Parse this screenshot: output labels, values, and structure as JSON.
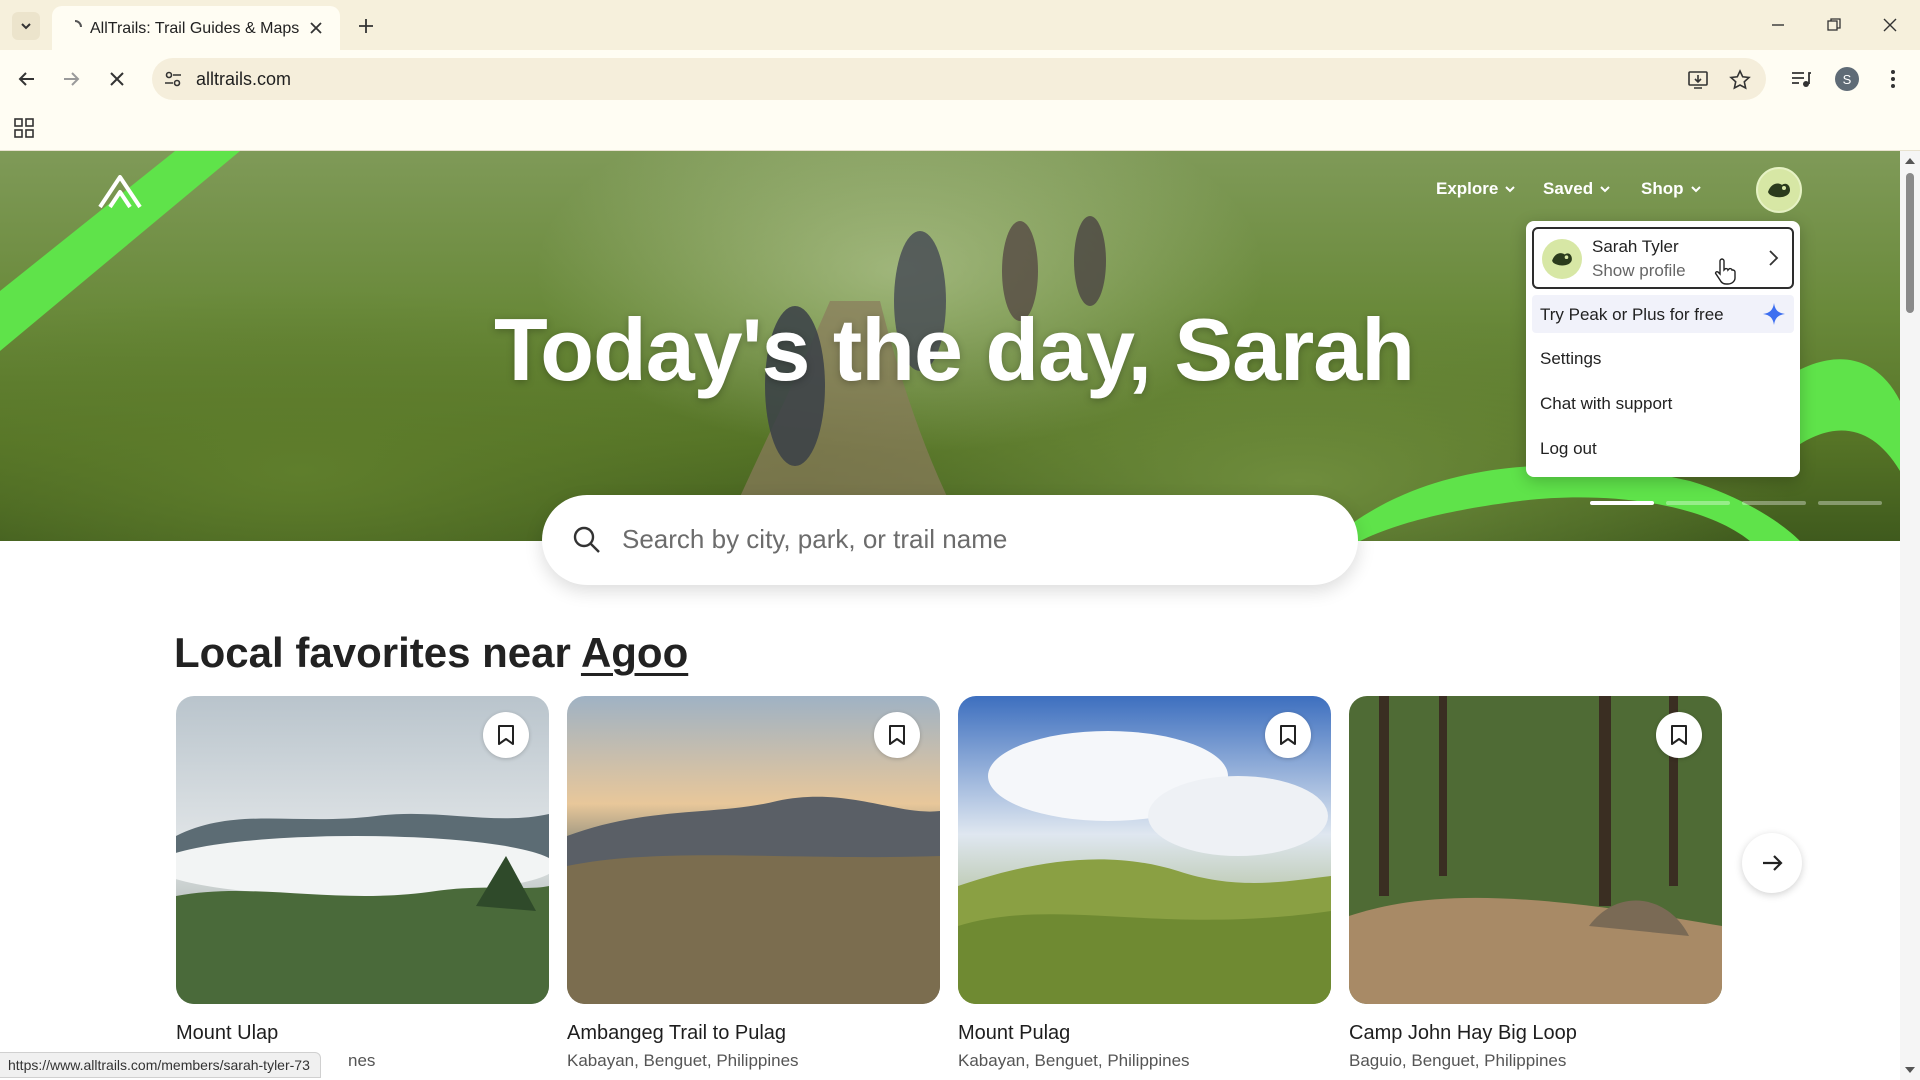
{
  "browser": {
    "tab_title": "AllTrails: Trail Guides & Maps fo",
    "url": "alltrails.com",
    "profile_initial": "S"
  },
  "nav": {
    "explore": "Explore",
    "saved": "Saved",
    "shop": "Shop"
  },
  "hero": {
    "headline": "Today's the day, Sarah",
    "carousel_slides": 4,
    "active_slide": 1
  },
  "search": {
    "placeholder": "Search by city, park, or trail name"
  },
  "user_menu": {
    "name": "Sarah Tyler",
    "subtitle": "Show profile",
    "items": [
      "Try Peak or Plus for free",
      "Settings",
      "Chat with support",
      "Log out"
    ]
  },
  "section": {
    "title_prefix": "Local favorites near ",
    "location": "Agoo"
  },
  "trails": [
    {
      "name": "Mount Ulap",
      "location": "nes"
    },
    {
      "name": "Ambangeg Trail to Pulag",
      "location": "Kabayan, Benguet, Philippines"
    },
    {
      "name": "Mount Pulag",
      "location": "Kabayan, Benguet, Philippines"
    },
    {
      "name": "Camp John Hay Big Loop",
      "location": "Baguio, Benguet, Philippines"
    }
  ],
  "status_bar": {
    "url": "https://www.alltrails.com/members/sarah-tyler-73"
  },
  "colors": {
    "brand_green": "#5fe34a",
    "accent_blue": "#3d6ff0"
  }
}
